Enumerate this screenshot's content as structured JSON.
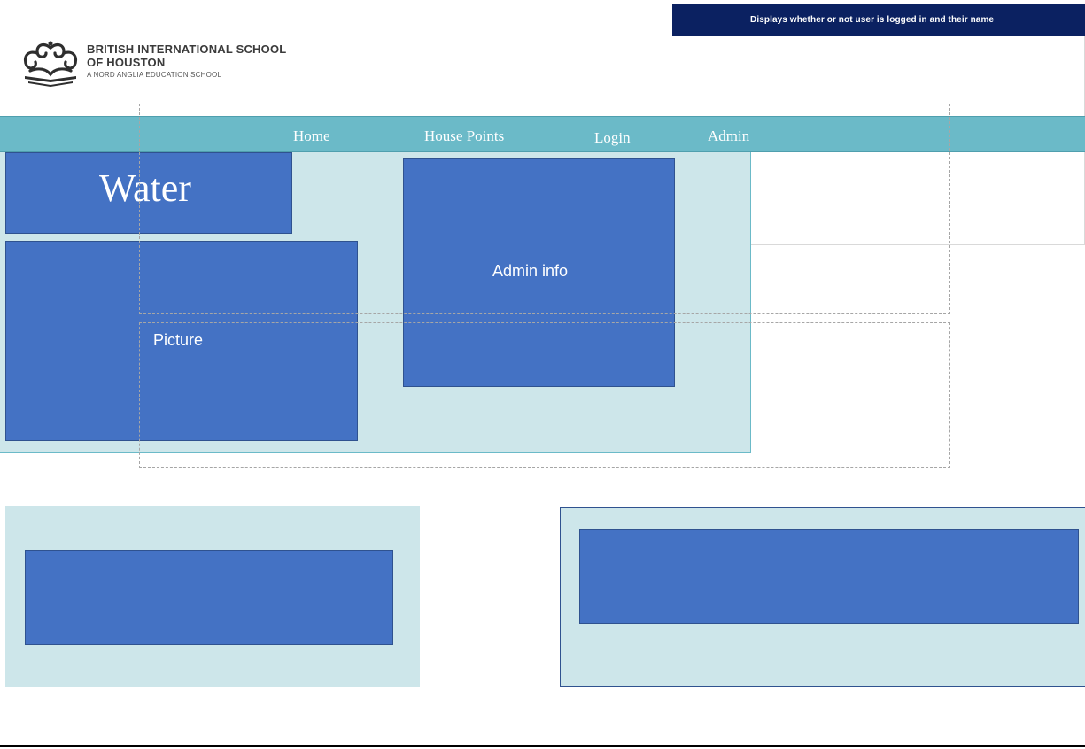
{
  "header": {
    "login_status_text": "Displays whether or not user is logged in and their name",
    "logo": {
      "line1": "BRITISH INTERNATIONAL SCHOOL",
      "line2": "OF HOUSTON",
      "tagline": "A NORD ANGLIA EDUCATION SCHOOL"
    }
  },
  "nav": {
    "items": [
      {
        "label": "Home"
      },
      {
        "label": "House Points"
      },
      {
        "label": "Login"
      },
      {
        "label": "Admin"
      }
    ]
  },
  "main": {
    "house_title": "Water",
    "picture_label": "Picture",
    "admin_info_label": "Admin info"
  },
  "colors": {
    "nav": "#6bbac8",
    "login_banner": "#0b2161",
    "panel_bg": "#cde6ea",
    "block": "#4472c4"
  }
}
